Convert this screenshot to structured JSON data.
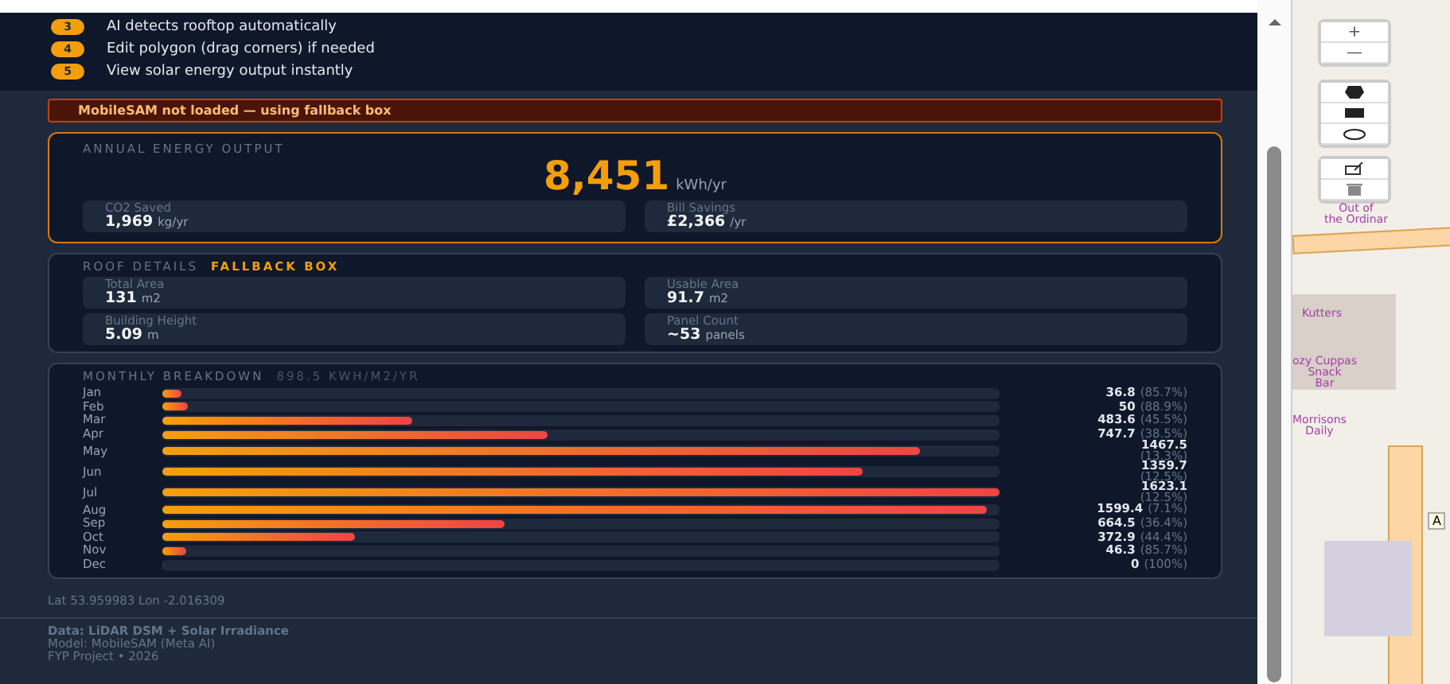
{
  "steps": [
    {
      "number": "3",
      "text": "AI detects rooftop automatically"
    },
    {
      "number": "4",
      "text": "Edit polygon (drag corners) if needed"
    },
    {
      "number": "5",
      "text": "View solar energy output instantly"
    }
  ],
  "warning": "MobileSAM not loaded — using fallback box",
  "annual": {
    "title": "ANNUAL ENERGY OUTPUT",
    "value": "8,451",
    "unit": "kWh/yr",
    "stats": [
      {
        "label": "CO2 Saved",
        "value": "1,969",
        "unit": "kg/yr"
      },
      {
        "label": "Bill Savings",
        "value": "£2,366",
        "unit": "/yr"
      }
    ]
  },
  "roof": {
    "title": "ROOF DETAILS",
    "badge": "FALLBACK BOX",
    "stats": [
      {
        "label": "Total Area",
        "value": "131",
        "unit": "m2"
      },
      {
        "label": "Usable Area",
        "value": "91.7",
        "unit": "m2"
      },
      {
        "label": "Building Height",
        "value": "5.09",
        "unit": "m"
      },
      {
        "label": "Panel Count",
        "value": "~53",
        "unit": "panels"
      }
    ]
  },
  "monthly": {
    "title": "MONTHLY BREAKDOWN",
    "subtitle": "898.5 KWH/M2/YR",
    "rows": [
      {
        "month": "Jan",
        "level": 0.023,
        "value": "36.8",
        "pct": "(85.7%)"
      },
      {
        "month": "Feb",
        "level": 0.031,
        "value": "50",
        "pct": "(88.9%)"
      },
      {
        "month": "Mar",
        "level": 0.298,
        "value": "483.6",
        "pct": "(45.5%)"
      },
      {
        "month": "Apr",
        "level": 0.461,
        "value": "747.7",
        "pct": "(38.5%)"
      },
      {
        "month": "May",
        "level": 0.904,
        "value": "1467.5",
        "pct": "(13.3%)"
      },
      {
        "month": "Jun",
        "level": 0.837,
        "value": "1359.7",
        "pct": "(12.5%)"
      },
      {
        "month": "Jul",
        "level": 1.0,
        "value": "1623.1",
        "pct": "(12.5%)"
      },
      {
        "month": "Aug",
        "level": 0.985,
        "value": "1599.4",
        "pct": "(7.1%)"
      },
      {
        "month": "Sep",
        "level": 0.409,
        "value": "664.5",
        "pct": "(36.4%)"
      },
      {
        "month": "Oct",
        "level": 0.23,
        "value": "372.9",
        "pct": "(44.4%)"
      },
      {
        "month": "Nov",
        "level": 0.029,
        "value": "46.3",
        "pct": "(85.7%)"
      },
      {
        "month": "Dec",
        "level": 0,
        "value": "0",
        "pct": "(100%)"
      }
    ]
  },
  "coords": "Lat 53.959983 Lon -2.016309",
  "footer": [
    "Data: LiDAR DSM + Solar Irradiance",
    "Model: MobileSAM (Meta AI)",
    "FYP Project • 2026"
  ],
  "map": {
    "zoom_in": "+",
    "zoom_out": "—",
    "labels": [
      "Out of\nthe Ordinar",
      "Kutters",
      "ozy Cuppas\nSnack\nBar",
      "Morrisons\nDaily"
    ],
    "road_label": "A"
  }
}
